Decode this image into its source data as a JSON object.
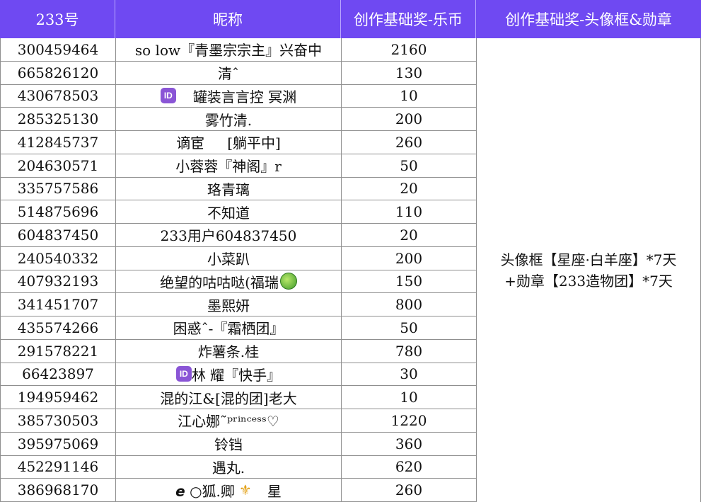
{
  "header": {
    "col_id": "233号",
    "col_name": "昵称",
    "col_coins": "创作基础奖-乐币",
    "col_reward": "创作基础奖-头像框&勋章"
  },
  "rows": [
    {
      "id": "300459464",
      "name": "so low『青墨宗宗主』兴奋中",
      "coins": "2160"
    },
    {
      "id": "665826120",
      "name": "清ˆ",
      "coins": "130"
    },
    {
      "id": "430678503",
      "name": "罐装言言控 冥渊",
      "coins": "10"
    },
    {
      "id": "285325130",
      "name": "雾竹清.",
      "coins": "200"
    },
    {
      "id": "412845737",
      "name": "谪宦",
      "name2": "[躺平中]",
      "coins": "260"
    },
    {
      "id": "204630571",
      "name": "小蓉蓉『神阁』r",
      "coins": "50"
    },
    {
      "id": "335757586",
      "name": "珞青璃",
      "coins": "20"
    },
    {
      "id": "514875696",
      "name": "不知道",
      "coins": "110"
    },
    {
      "id": "604837450",
      "name": "233用户604837450",
      "coins": "20"
    },
    {
      "id": "240540332",
      "name": "小菜趴",
      "coins": "200"
    },
    {
      "id": "407932193",
      "name": "绝望的咕咕哒(福瑞",
      "coins": "150"
    },
    {
      "id": "341451707",
      "name": "墨熙妍",
      "coins": "800"
    },
    {
      "id": "435574266",
      "name": "困惑ˆ-『霜栖团』",
      "coins": "50"
    },
    {
      "id": "291578221",
      "name": "炸薯条.桂",
      "coins": "780"
    },
    {
      "id": "66423897",
      "name": "林 耀『快手』",
      "coins": "30"
    },
    {
      "id": "194959462",
      "name": "混的江&[混的团]老大",
      "coins": "10"
    },
    {
      "id": "385730503",
      "name": "江心娜˜ᵖʳⁱⁿᶜᵉˢˢ♡",
      "coins": "1220"
    },
    {
      "id": "395975069",
      "name": "铃铛",
      "coins": "360"
    },
    {
      "id": "452291146",
      "name": "遇丸.",
      "coins": "620"
    },
    {
      "id": "386968170",
      "name": "𝙚 ○狐.卿",
      "name2": "星",
      "coins": "260"
    }
  ],
  "reward": {
    "line1": "头像框【星座·白羊座】*7天",
    "line2": "+勋章【233造物团】*7天"
  },
  "icons": {
    "id_badge": "ID",
    "leaf_emoji": "green-leaf-icon",
    "fleur_emoji": "fleur-de-lis-icon"
  },
  "colors": {
    "header_bg": "#6f49f2",
    "header_text": "#ffffff",
    "grid": "#8f8f8f"
  }
}
